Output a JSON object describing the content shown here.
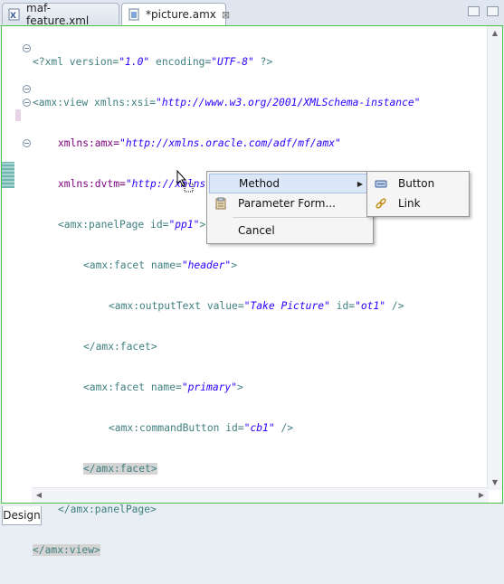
{
  "tabs": [
    {
      "label": "maf-feature.xml",
      "icon": "xml-file-icon",
      "active": false
    },
    {
      "label": "*picture.amx",
      "icon": "amx-file-icon",
      "active": true,
      "close": "⊠"
    }
  ],
  "code_lines": [
    [
      "<?xml version=",
      "\"1.0\"",
      " encoding=",
      "\"UTF-8\"",
      " ?>"
    ],
    [
      "<amx:view xmlns:xsi=",
      "\"http://www.w3.org/2001/XMLSchema-instance\""
    ],
    [
      "xmlns:amx=",
      "\"http://xmlns.oracle.com/adf/mf/amx\""
    ],
    [
      "xmlns:dvtm=",
      "\"http://xmlns.oracle.com/adf/mf/amx/dvt\"",
      ">"
    ],
    [
      "<amx:panelPage id=",
      "\"pp1\"",
      ">"
    ],
    [
      "<amx:facet name=",
      "\"header\"",
      ">"
    ],
    [
      "<amx:outputText value=",
      "\"Take Picture\"",
      " id=",
      "\"ot1\"",
      " />"
    ],
    [
      "</amx:facet>"
    ],
    [
      "<amx:facet name=",
      "\"primary\"",
      ">"
    ],
    [
      "<amx:commandButton id=",
      "\"cb1\"",
      " />"
    ],
    [
      "</amx:facet>"
    ],
    [
      "</amx:panelPage>"
    ],
    [
      "</amx:view>"
    ]
  ],
  "context_menu": {
    "items": [
      {
        "label": "Method",
        "icon": "none",
        "submenu": true
      },
      {
        "label": "Parameter Form...",
        "icon": "clipboard-icon"
      },
      {
        "label": "Cancel",
        "icon": "none"
      }
    ]
  },
  "submenu": {
    "items": [
      {
        "label": "Button",
        "icon": "button-icon"
      },
      {
        "label": "Link",
        "icon": "link-icon"
      }
    ]
  },
  "bottom_tabs": [
    {
      "label": "Design"
    }
  ],
  "colors": {
    "tag": "#3f7f7f",
    "attribute_name": "#7f007f",
    "attribute_value": "#2a00ff",
    "editor_border": "#49c24a",
    "menu_highlight": "#dbe7f7"
  }
}
